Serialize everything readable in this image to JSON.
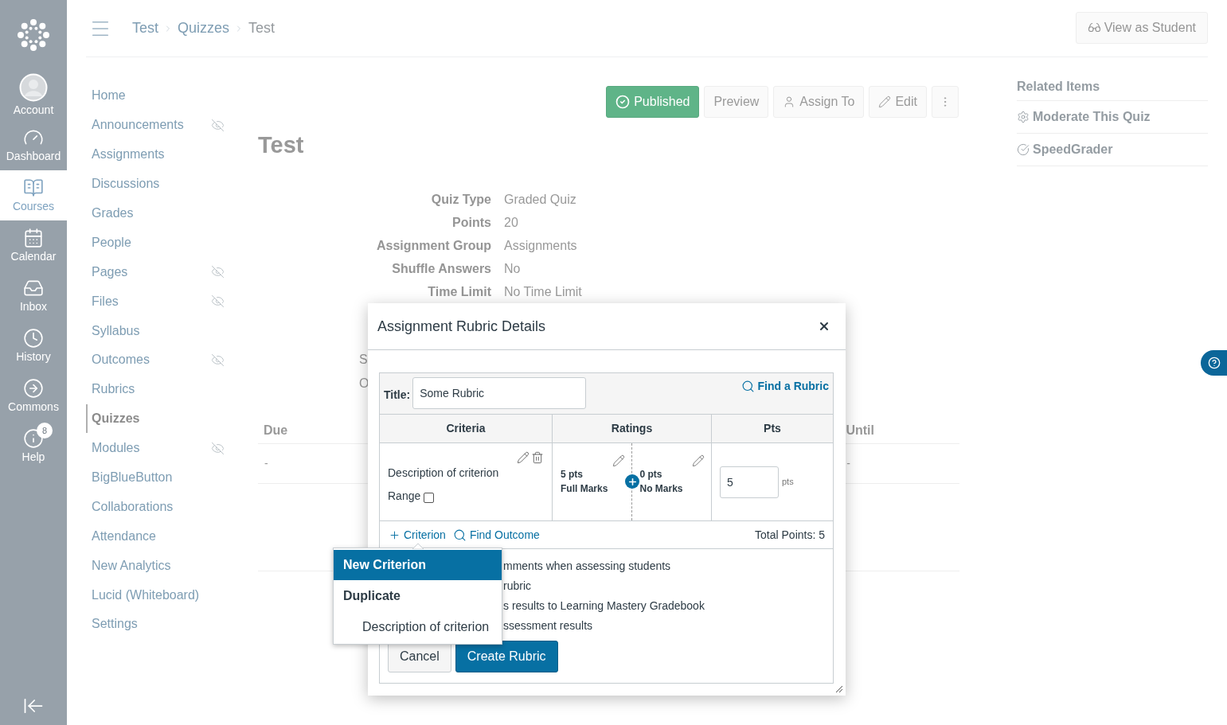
{
  "global_nav": [
    {
      "label": "Account",
      "kind": "account",
      "selected": false
    },
    {
      "label": "Dashboard",
      "kind": "dashboard",
      "selected": false
    },
    {
      "label": "Courses",
      "kind": "courses",
      "selected": true
    },
    {
      "label": "Calendar",
      "kind": "calendar",
      "selected": false
    },
    {
      "label": "Inbox",
      "kind": "inbox",
      "selected": false
    },
    {
      "label": "History",
      "kind": "history",
      "selected": false
    },
    {
      "label": "Commons",
      "kind": "commons",
      "selected": false
    },
    {
      "label": "Help",
      "kind": "help",
      "selected": false,
      "badge": "8"
    }
  ],
  "breadcrumbs": [
    "Test",
    "Quizzes",
    "Test"
  ],
  "view_as_student": "View as Student",
  "course_nav": [
    {
      "label": "Home",
      "hidden": false,
      "selected": false
    },
    {
      "label": "Announcements",
      "hidden": true,
      "selected": false
    },
    {
      "label": "Assignments",
      "hidden": false,
      "selected": false
    },
    {
      "label": "Discussions",
      "hidden": false,
      "selected": false
    },
    {
      "label": "Grades",
      "hidden": false,
      "selected": false
    },
    {
      "label": "People",
      "hidden": false,
      "selected": false
    },
    {
      "label": "Pages",
      "hidden": true,
      "selected": false
    },
    {
      "label": "Files",
      "hidden": true,
      "selected": false
    },
    {
      "label": "Syllabus",
      "hidden": false,
      "selected": false
    },
    {
      "label": "Outcomes",
      "hidden": true,
      "selected": false
    },
    {
      "label": "Rubrics",
      "hidden": false,
      "selected": false
    },
    {
      "label": "Quizzes",
      "hidden": false,
      "selected": true
    },
    {
      "label": "Modules",
      "hidden": true,
      "selected": false
    },
    {
      "label": "BigBlueButton",
      "hidden": false,
      "selected": false
    },
    {
      "label": "Collaborations",
      "hidden": false,
      "selected": false
    },
    {
      "label": "Attendance",
      "hidden": false,
      "selected": false
    },
    {
      "label": "New Analytics",
      "hidden": false,
      "selected": false
    },
    {
      "label": "Lucid (Whiteboard)",
      "hidden": false,
      "selected": false
    },
    {
      "label": "Settings",
      "hidden": false,
      "selected": false
    }
  ],
  "toolbar": [
    {
      "label": "Published",
      "kind": "published"
    },
    {
      "label": "Preview",
      "kind": "plain"
    },
    {
      "label": "Assign To",
      "kind": "assign"
    },
    {
      "label": "Edit",
      "kind": "edit"
    },
    {
      "kind": "more"
    }
  ],
  "title": "Test",
  "details": [
    {
      "label": "Quiz Type",
      "value": "Graded Quiz"
    },
    {
      "label": "Points",
      "value": "20"
    },
    {
      "label": "Assignment Group",
      "value": "Assignments"
    },
    {
      "label": "Shuffle Answers",
      "value": "No"
    },
    {
      "label": "Time Limit",
      "value": "No Time Limit"
    }
  ],
  "peek_letters": [
    "S",
    "O"
  ],
  "dates_table": {
    "columns": [
      "Due",
      "Until"
    ],
    "rows": [
      [
        "-",
        "-"
      ]
    ]
  },
  "related": {
    "title": "Related Items",
    "items": [
      {
        "label": "Moderate This Quiz",
        "kind": "gear"
      },
      {
        "label": "SpeedGrader",
        "kind": "speedgrader"
      }
    ]
  },
  "modal": {
    "title": "Assignment Rubric Details",
    "title_label": "Title:",
    "title_value": "Some Rubric",
    "find_rubric": "Find a Rubric",
    "columns": [
      "Criteria",
      "Ratings",
      "Pts"
    ],
    "criterion": {
      "description": "Description of criterion",
      "range_label": "Range",
      "range_checked": false,
      "ratings": [
        {
          "points": "5 pts",
          "label": "Full Marks"
        },
        {
          "points": "0 pts",
          "label": "No Marks"
        }
      ],
      "points_value": "5",
      "points_unit": "pts"
    },
    "add_criterion": "Criterion",
    "find_outcome": "Find Outcome",
    "total": "Total Points: 5",
    "options": [
      "mments when assessing students",
      "rubric",
      "s results to Learning Mastery Gradebook",
      "ssessment results"
    ],
    "cancel": "Cancel",
    "create": "Create Rubric",
    "menu": [
      {
        "label": "New Criterion",
        "kind": "option",
        "selected": true
      },
      {
        "label": "Duplicate",
        "kind": "group",
        "selected": false
      },
      {
        "label": "Description of criterion",
        "kind": "option",
        "selected": false
      }
    ]
  }
}
